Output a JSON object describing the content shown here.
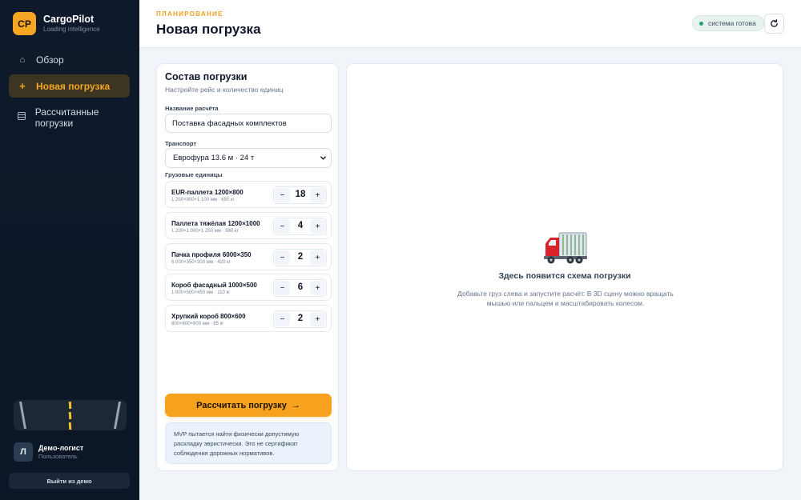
{
  "brand": {
    "initials": "CP",
    "name": "CargoPilot",
    "tagline": "Loading intelligence"
  },
  "nav": [
    {
      "label": "Обзор",
      "icon": "home-icon",
      "active": false
    },
    {
      "label": "Новая погрузка",
      "icon": "plus-icon",
      "active": true
    },
    {
      "label": "Рассчитанные погрузки",
      "icon": "list-icon",
      "active": false
    }
  ],
  "user": {
    "initial": "Л",
    "name": "Демо-логист",
    "role": "Пользователь"
  },
  "logout_label": "Выйти из демо",
  "header": {
    "kicker": "ПЛАНИРОВАНИЕ",
    "title": "Новая погрузка",
    "status": "система готова"
  },
  "form": {
    "title": "Состав погрузки",
    "subtitle": "Настройте рейс и количество единиц",
    "name_label": "Название расчёта",
    "name_value": "Поставка фасадных комплектов",
    "transport_label": "Транспорт",
    "transport_value": "Еврофура 13.6 м · 24 т",
    "units_label": "Грузовые единицы",
    "units": [
      {
        "name": "EUR-паллета 1200×800",
        "meta": "1 200×800×1 100 мм · 650 кг",
        "qty": "18"
      },
      {
        "name": "Паллета тяжёлая 1200×1000",
        "meta": "1 200×1 000×1 250 мм · 980 кг",
        "qty": "4"
      },
      {
        "name": "Пачка профиля 6000×350",
        "meta": "6 000×350×300 мм · 420 кг",
        "qty": "2"
      },
      {
        "name": "Короб фасадный 1000×500",
        "meta": "1 000×500×450 мм · 110 кг",
        "qty": "6"
      },
      {
        "name": "Хрупкий короб 800×600",
        "meta": "800×600×600 мм · 85 кг",
        "qty": "2"
      }
    ],
    "calculate_label": "Рассчитать погрузку",
    "note": "MVP пытается найти физически допустимую раскладку эвристически. Это не сертификат соблюдения дорожных нормативов."
  },
  "viewer": {
    "empty_title": "Здесь появится схема погрузки",
    "empty_desc": "Добавьте груз слева и запустите расчёт. В 3D сцену можно вращать мышью или пальцем и масштабировать колесом."
  },
  "colors": {
    "accent": "#f6a21e",
    "sidebar": "#0e1a2b",
    "status_ok": "#22a06b"
  }
}
